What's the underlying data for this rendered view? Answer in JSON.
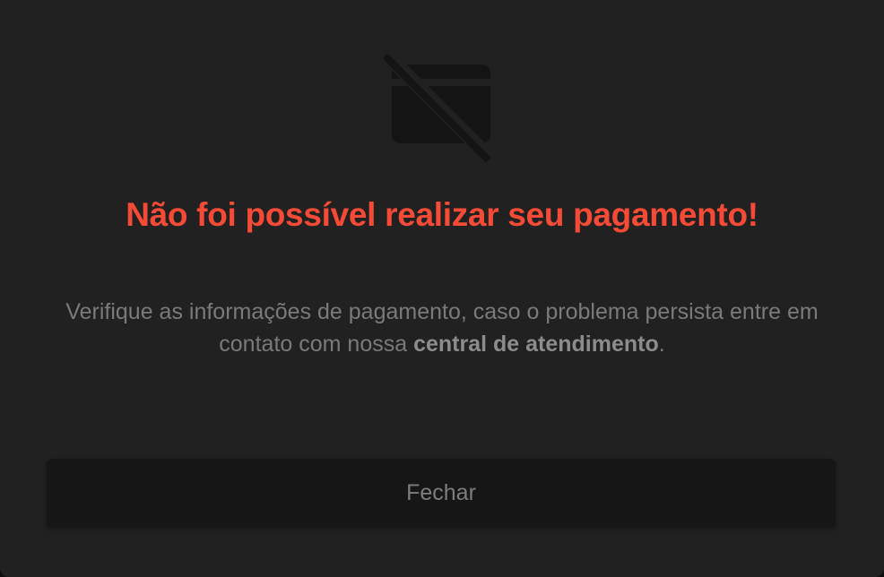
{
  "modal": {
    "icon": "credit-card-off-icon",
    "title": "Não foi possível realizar seu pagamento!",
    "message_part1": "Verifique as informações de pagamento, caso o problema persista entre em contato com nossa ",
    "message_link": "central de atendimento",
    "message_part2": ".",
    "close_label": "Fechar"
  },
  "colors": {
    "background": "#212121",
    "title": "#f44a36",
    "text": "#7a7a7a",
    "button_bg": "#161616",
    "icon": "#131313"
  }
}
